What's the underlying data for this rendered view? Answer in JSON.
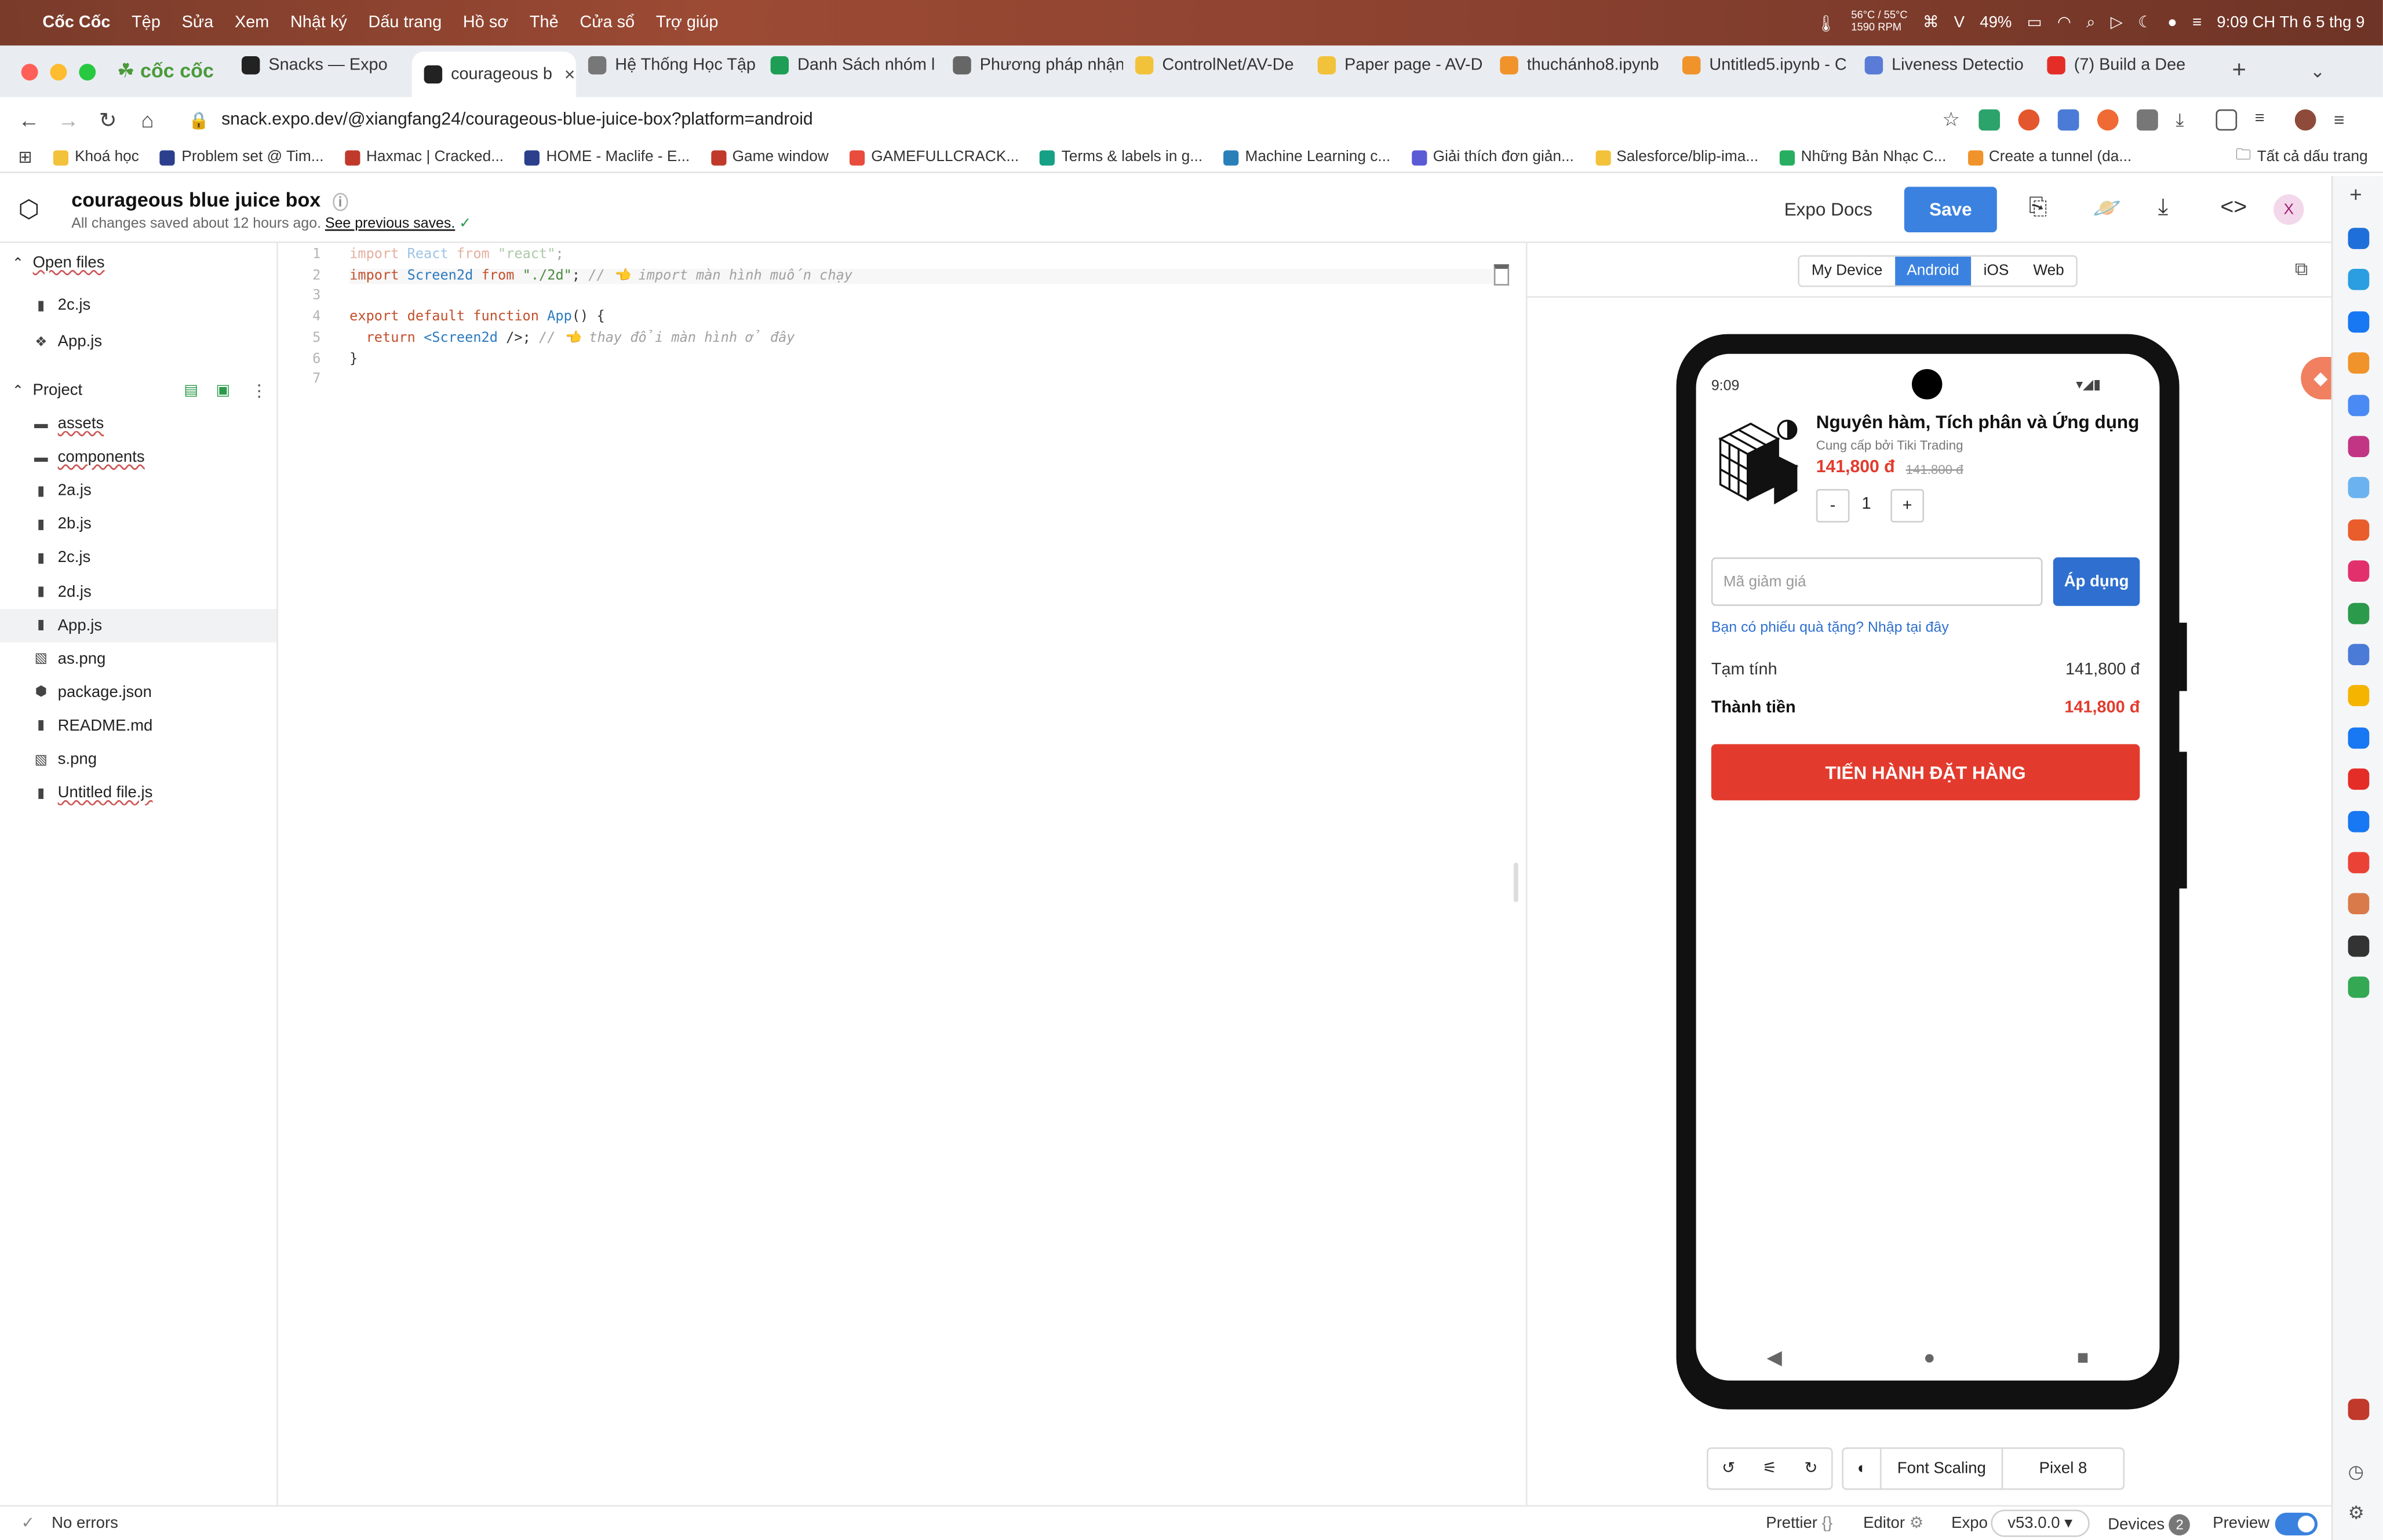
{
  "menubar": {
    "app_name": "Cốc Cốc",
    "items": [
      "Tệp",
      "Sửa",
      "Xem",
      "Nhật ký",
      "Dấu trang",
      "Hồ sơ",
      "Thẻ",
      "Cửa sổ",
      "Trợ giúp"
    ],
    "temperature": "56°C / 55°C",
    "fan": "1590 RPM",
    "battery": "49%",
    "clock": "9:09 CH Th 6 5 thg 9"
  },
  "tabs": [
    {
      "title": "Snacks — Expo",
      "color": "#222222"
    },
    {
      "title": "courageous b",
      "color": "#222222",
      "active": true
    },
    {
      "title": "Hệ Thống Học Tập",
      "color": "#777777"
    },
    {
      "title": "Danh Sách nhóm l",
      "color": "#1e9e55"
    },
    {
      "title": "Phương pháp nhận",
      "color": "#666666"
    },
    {
      "title": "ControlNet/AV-De",
      "color": "#f3c23b"
    },
    {
      "title": "Paper page - AV-D",
      "color": "#f3c23b"
    },
    {
      "title": "thuchánho8.ipynb",
      "color": "#f0932b"
    },
    {
      "title": "Untitled5.ipynb - C",
      "color": "#f0932b"
    },
    {
      "title": "Liveness Detectio",
      "color": "#5a7bd6"
    },
    {
      "title": "(7) Build a Dee",
      "color": "#e52d27"
    }
  ],
  "browser": {
    "brand": "cốc cốc",
    "url": "snack.expo.dev/@xiangfang24/courageous-blue-juice-box?platform=android",
    "all_bookmarks": "Tất cả dấu trang"
  },
  "bookmarks": [
    {
      "label": "Khoá học",
      "color": "#f3c23b"
    },
    {
      "label": "Problem set @ Tim...",
      "color": "#2b3f8c"
    },
    {
      "label": "Haxmac | Cracked...",
      "color": "#c0392b"
    },
    {
      "label": "HOME - Maclife - E...",
      "color": "#2b3f8c"
    },
    {
      "label": "Game window",
      "color": "#c0392b"
    },
    {
      "label": "GAMEFULLCRACK...",
      "color": "#e74c3c"
    },
    {
      "label": "Terms & labels in g...",
      "color": "#16a085"
    },
    {
      "label": "Machine Learning c...",
      "color": "#2980b9"
    },
    {
      "label": "Giải thích đơn giản...",
      "color": "#5b5bd6"
    },
    {
      "label": "Salesforce/blip-ima...",
      "color": "#f3c23b"
    },
    {
      "label": "Những Bản Nhạc C...",
      "color": "#27ae60"
    },
    {
      "label": "Create a tunnel (da...",
      "color": "#f0932b"
    }
  ],
  "header": {
    "title": "courageous blue juice box",
    "saved_text": "All changes saved about 12 hours ago.",
    "previous_saves": "See previous saves.",
    "docs": "Expo Docs",
    "save": "Save",
    "avatar": "X"
  },
  "sidebar": {
    "open_files_label": "Open files",
    "open_files": [
      "2c.js",
      "App.js"
    ],
    "project_label": "Project",
    "project_items": [
      {
        "name": "assets",
        "type": "folder"
      },
      {
        "name": "components",
        "type": "folder"
      },
      {
        "name": "2a.js",
        "type": "file"
      },
      {
        "name": "2b.js",
        "type": "file"
      },
      {
        "name": "2c.js",
        "type": "file"
      },
      {
        "name": "2d.js",
        "type": "file"
      },
      {
        "name": "App.js",
        "type": "file",
        "selected": true
      },
      {
        "name": "as.png",
        "type": "image"
      },
      {
        "name": "package.json",
        "type": "package"
      },
      {
        "name": "README.md",
        "type": "file"
      },
      {
        "name": "s.png",
        "type": "image"
      },
      {
        "name": "Untitled file.js",
        "type": "file"
      }
    ]
  },
  "editor": {
    "lines": [
      {
        "n": "1",
        "segments": [
          [
            "kw",
            "import "
          ],
          [
            "fn",
            "React "
          ],
          [
            "kw",
            "from "
          ],
          [
            "str",
            "\"react\""
          ],
          [
            "",
            "; "
          ]
        ],
        "faded": true
      },
      {
        "n": "2",
        "segments": [
          [
            "kw",
            "import "
          ],
          [
            "fn",
            "Screen2d "
          ],
          [
            "kw",
            "from "
          ],
          [
            "str",
            "\"./2d\""
          ],
          [
            "",
            "; "
          ],
          [
            "cm",
            "// 👈 import màn hình muốn chạy"
          ]
        ]
      },
      {
        "n": "3",
        "segments": []
      },
      {
        "n": "4",
        "segments": [
          [
            "kw",
            "export default function "
          ],
          [
            "fn",
            "App"
          ],
          [
            "",
            "() {"
          ]
        ]
      },
      {
        "n": "5",
        "segments": [
          [
            "kw",
            "  return "
          ],
          [
            "fn",
            "<Screen2d "
          ],
          [
            "",
            "/>"
          ],
          [
            "",
            "; "
          ],
          [
            "cm",
            "// 👈 thay đổi màn hình ở đây"
          ]
        ]
      },
      {
        "n": "6",
        "segments": [
          [
            "",
            "}"
          ]
        ]
      },
      {
        "n": "7",
        "segments": []
      }
    ]
  },
  "preview": {
    "platforms": [
      "My Device",
      "Android",
      "iOS",
      "Web"
    ],
    "active_platform": "Android",
    "font_scaling": "Font Scaling",
    "device": "Pixel 8"
  },
  "phone": {
    "time": "9:09",
    "product_name": "Nguyên hàm, Tích phân và Ứng dụng",
    "seller": "Cung cấp bởi Tiki Trading",
    "price": "141,800 đ",
    "old_price": "141.800 đ",
    "minus": "-",
    "plus": "+",
    "quantity": "1",
    "coupon_placeholder": "Mã giảm giá",
    "apply": "Áp dụng",
    "gift_link": "Bạn có phiếu quà tặng? Nhập tại đây",
    "subtotal_label": "Tạm tính",
    "subtotal_value": "141,800 đ",
    "total_label": "Thành tiền",
    "total_value": "141,800 đ",
    "order_button": "TIẾN HÀNH ĐẶT HÀNG"
  },
  "statusbar": {
    "errors": "No errors",
    "prettier": "Prettier",
    "editor": "Editor",
    "expo": "Expo",
    "version": "v53.0.0",
    "devices": "Devices",
    "devices_count": "2",
    "preview": "Preview"
  }
}
